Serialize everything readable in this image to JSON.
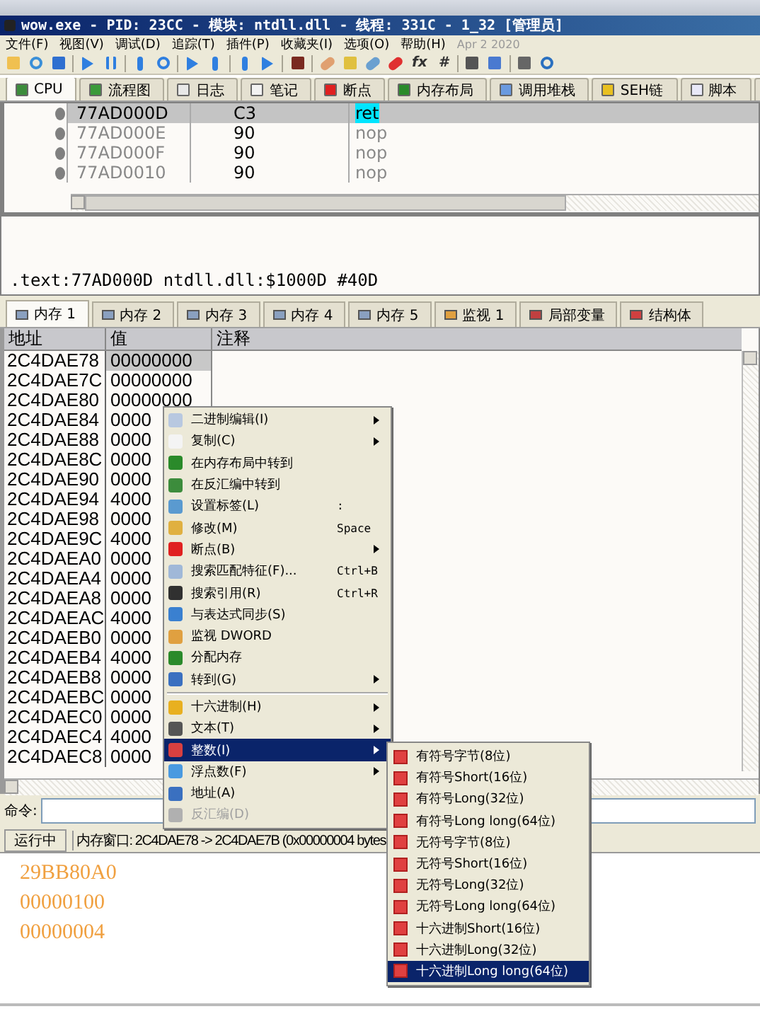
{
  "window": {
    "title": "wow.exe - PID: 23CC - 模块: ntdll.dll - 线程: 331C - 1_32 [管理员]"
  },
  "menubar": {
    "items": [
      "文件(F)",
      "视图(V)",
      "调试(D)",
      "追踪(T)",
      "插件(P)",
      "收藏夹(I)",
      "选项(O)",
      "帮助(H)"
    ],
    "date": "Apr 2 2020"
  },
  "toolbar": {
    "glyphs": [
      "fx",
      "#"
    ]
  },
  "tabs": [
    {
      "label": "CPU",
      "selected": true
    },
    {
      "label": "流程图",
      "selected": false
    },
    {
      "label": "日志",
      "selected": false
    },
    {
      "label": "笔记",
      "selected": false
    },
    {
      "label": "断点",
      "selected": false
    },
    {
      "label": "内存布局",
      "selected": false
    },
    {
      "label": "调用堆栈",
      "selected": false
    },
    {
      "label": "SEH链",
      "selected": false
    },
    {
      "label": "脚本",
      "selected": false
    },
    {
      "selected": false
    }
  ],
  "disassembly": {
    "rows": [
      {
        "address": "77AD000D",
        "bytes": "C3",
        "instruction": "ret",
        "selected": true
      },
      {
        "address": "77AD000E",
        "bytes": "90",
        "instruction": "nop",
        "selected": false
      },
      {
        "address": "77AD000F",
        "bytes": "90",
        "instruction": "nop",
        "selected": false
      },
      {
        "address": "77AD0010",
        "bytes": "90",
        "instruction": "nop",
        "selected": false
      }
    ]
  },
  "info_line": ".text:77AD000D ntdll.dll:$1000D #40D",
  "memory_tabs": [
    {
      "label": "内存 1",
      "selected": true
    },
    {
      "label": "内存 2",
      "selected": false
    },
    {
      "label": "内存 3",
      "selected": false
    },
    {
      "label": "内存 4",
      "selected": false
    },
    {
      "label": "内存 5",
      "selected": false
    },
    {
      "label": "监视 1",
      "selected": false
    },
    {
      "label": "局部变量",
      "selected": false
    },
    {
      "label": "结构体",
      "selected": false
    }
  ],
  "memory_table": {
    "columns": [
      "地址",
      "值",
      "注释"
    ],
    "rows": [
      {
        "address": "2C4DAE78",
        "value": "00000000",
        "selected": true
      },
      {
        "address": "2C4DAE7C",
        "value": "00000000",
        "selected": false
      },
      {
        "address": "2C4DAE80",
        "value": "00000000",
        "selected": false
      },
      {
        "address": "2C4DAE84",
        "value": "0000",
        "selected": false
      },
      {
        "address": "2C4DAE88",
        "value": "0000",
        "selected": false
      },
      {
        "address": "2C4DAE8C",
        "value": "0000",
        "selected": false
      },
      {
        "address": "2C4DAE90",
        "value": "0000",
        "selected": false
      },
      {
        "address": "2C4DAE94",
        "value": "4000",
        "selected": false
      },
      {
        "address": "2C4DAE98",
        "value": "0000",
        "selected": false
      },
      {
        "address": "2C4DAE9C",
        "value": "4000",
        "selected": false
      },
      {
        "address": "2C4DAEA0",
        "value": "0000",
        "selected": false
      },
      {
        "address": "2C4DAEA4",
        "value": "0000",
        "selected": false
      },
      {
        "address": "2C4DAEA8",
        "value": "0000",
        "selected": false
      },
      {
        "address": "2C4DAEAC",
        "value": "4000",
        "selected": false
      },
      {
        "address": "2C4DAEB0",
        "value": "0000",
        "selected": false
      },
      {
        "address": "2C4DAEB4",
        "value": "4000",
        "selected": false
      },
      {
        "address": "2C4DAEB8",
        "value": "0000",
        "selected": false
      },
      {
        "address": "2C4DAEBC",
        "value": "0000",
        "selected": false
      },
      {
        "address": "2C4DAEC0",
        "value": "0000",
        "selected": false
      },
      {
        "address": "2C4DAEC4",
        "value": "4000",
        "selected": false
      },
      {
        "address": "2C4DAEC8",
        "value": "0000",
        "selected": false
      }
    ]
  },
  "command": {
    "label": "命令:"
  },
  "status_bar": {
    "state": "运行中",
    "text": "内存窗口: 2C4DAE78 -> 2C4DAE7B (0x00000004 bytes"
  },
  "context_menu": {
    "groups": [
      [
        {
          "label": "二进制编辑(I)",
          "submenu": true,
          "selected": false,
          "disabled": false
        },
        {
          "label": "复制(C)",
          "submenu": true,
          "selected": false,
          "disabled": false
        },
        {
          "label": "在内存布局中转到",
          "submenu": false,
          "selected": false,
          "disabled": false
        },
        {
          "label": "在反汇编中转到",
          "submenu": false,
          "selected": false,
          "disabled": false
        },
        {
          "label": "设置标签(L)",
          "shortcut": ":",
          "submenu": false,
          "selected": false,
          "disabled": false
        },
        {
          "label": "修改(M)",
          "shortcut": "Space",
          "submenu": false,
          "selected": false,
          "disabled": false
        },
        {
          "label": "断点(B)",
          "submenu": true,
          "selected": false,
          "disabled": false
        },
        {
          "label": "搜索匹配特征(F)...",
          "shortcut": "Ctrl+B",
          "submenu": false,
          "selected": false,
          "disabled": false
        },
        {
          "label": "搜索引用(R)",
          "shortcut": "Ctrl+R",
          "submenu": false,
          "selected": false,
          "disabled": false
        },
        {
          "label": "与表达式同步(S)",
          "submenu": false,
          "selected": false,
          "disabled": false
        },
        {
          "label": "监视 DWORD",
          "submenu": false,
          "selected": false,
          "disabled": false
        },
        {
          "label": "分配内存",
          "submenu": false,
          "selected": false,
          "disabled": false
        },
        {
          "label": "转到(G)",
          "submenu": true,
          "selected": false,
          "disabled": false
        }
      ],
      [
        {
          "label": "十六进制(H)",
          "submenu": true,
          "selected": false,
          "disabled": false
        },
        {
          "label": "文本(T)",
          "submenu": true,
          "selected": false,
          "disabled": false
        },
        {
          "label": "整数(I)",
          "submenu": true,
          "selected": true,
          "disabled": false
        },
        {
          "label": "浮点数(F)",
          "submenu": true,
          "selected": false,
          "disabled": false
        },
        {
          "label": "地址(A)",
          "submenu": false,
          "selected": false,
          "disabled": false
        },
        {
          "label": "反汇编(D)",
          "submenu": false,
          "selected": false,
          "disabled": true
        }
      ]
    ]
  },
  "submenu": {
    "items": [
      {
        "label": "有符号字节(8位)",
        "selected": false
      },
      {
        "label": "有符号Short(16位)",
        "selected": false
      },
      {
        "label": "有符号Long(32位)",
        "selected": false
      },
      {
        "label": "有符号Long long(64位)",
        "selected": false
      },
      {
        "label": "无符号字节(8位)",
        "selected": false
      },
      {
        "label": "无符号Short(16位)",
        "selected": false
      },
      {
        "label": "无符号Long(32位)",
        "selected": false
      },
      {
        "label": "无符号Long long(64位)",
        "selected": false
      },
      {
        "label": "十六进制Short(16位)",
        "selected": false
      },
      {
        "label": "十六进制Long(32位)",
        "selected": false
      },
      {
        "label": "十六进制Long long(64位)",
        "selected": true
      }
    ]
  },
  "output_lines": [
    "29BB80A0",
    "00000100",
    "00000004"
  ]
}
